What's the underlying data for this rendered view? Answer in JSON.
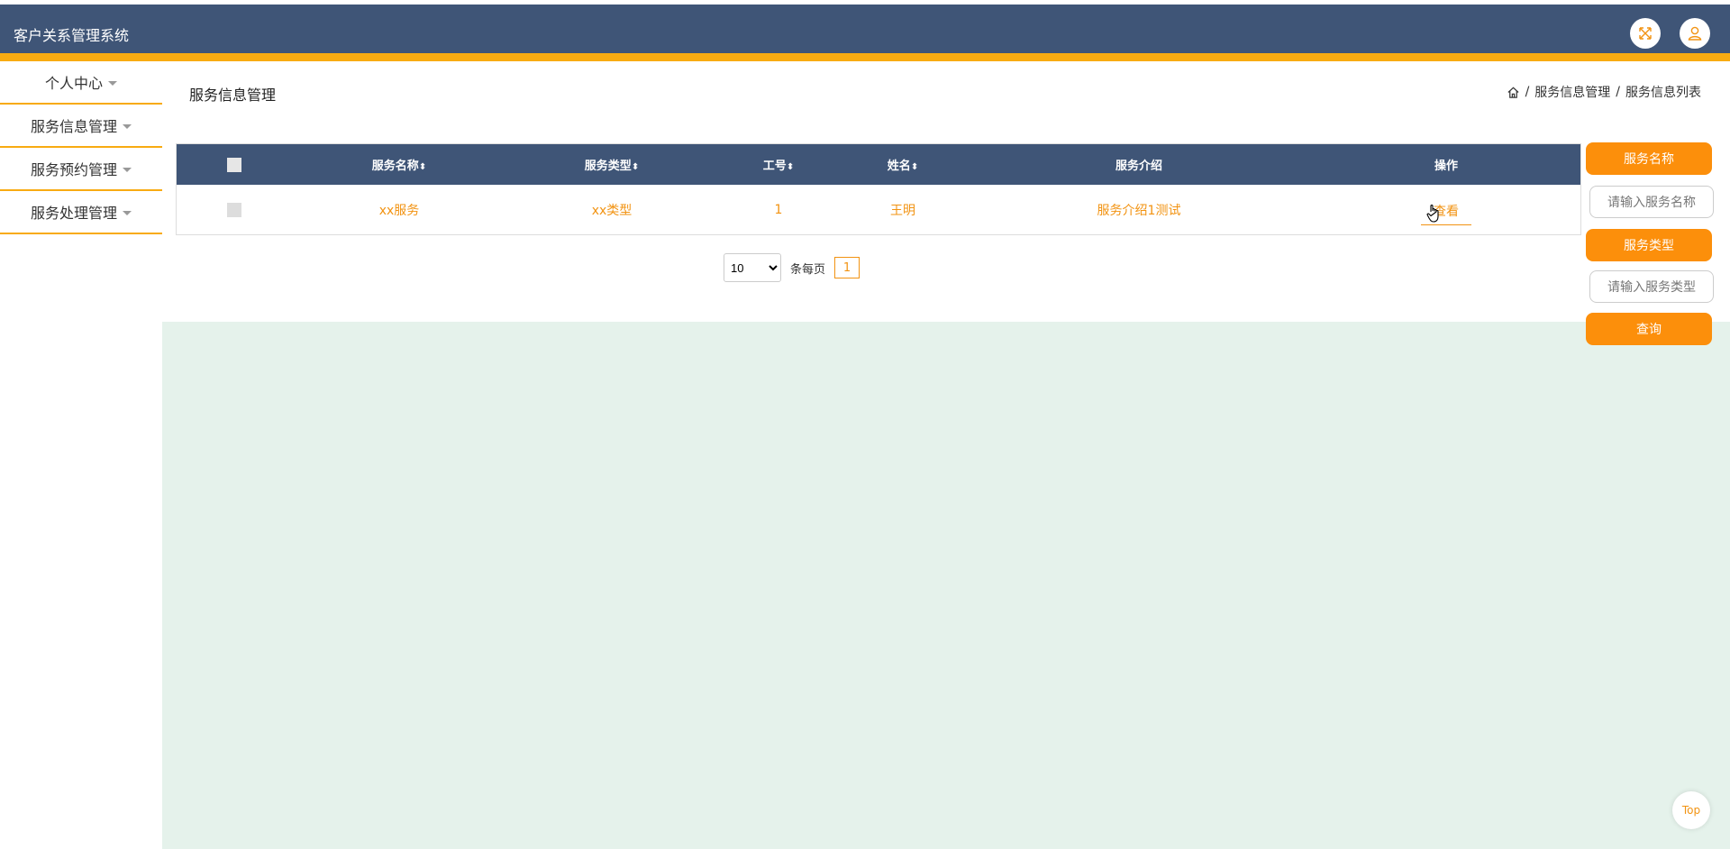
{
  "app": {
    "title": "客户关系管理系统"
  },
  "header_icons": {
    "fullscreen": "fullscreen-icon",
    "user": "user-icon"
  },
  "sidebar": {
    "items": [
      {
        "label": "个人中心"
      },
      {
        "label": "服务信息管理"
      },
      {
        "label": "服务预约管理"
      },
      {
        "label": "服务处理管理"
      }
    ]
  },
  "page": {
    "title": "服务信息管理"
  },
  "breadcrumb": {
    "items": [
      "服务信息管理",
      "服务信息列表"
    ],
    "separator": "/"
  },
  "table": {
    "columns": [
      "服务名称",
      "服务类型",
      "工号",
      "姓名",
      "服务介绍",
      "操作"
    ],
    "sortable": [
      "服务名称",
      "服务类型",
      "工号",
      "姓名"
    ],
    "rows": [
      {
        "name": "xx服务",
        "type": "xx类型",
        "id": "1",
        "person": "王明",
        "intro": "服务介绍1测试",
        "action": "查看"
      }
    ]
  },
  "pager": {
    "page_size": "10",
    "page_size_options": [
      "10"
    ],
    "per_page_label": "条每页",
    "current_page": "1"
  },
  "search": {
    "name_label": "服务名称",
    "name_placeholder": "请输入服务名称",
    "type_label": "服务类型",
    "type_placeholder": "请输入服务类型",
    "query_label": "查询"
  },
  "back_to_top": "Top",
  "colors": {
    "header": "#3f5577",
    "accent": "#f8ab12",
    "button": "#fc8f0b",
    "link": "#f29312",
    "content_bg": "#e5f2eb"
  }
}
